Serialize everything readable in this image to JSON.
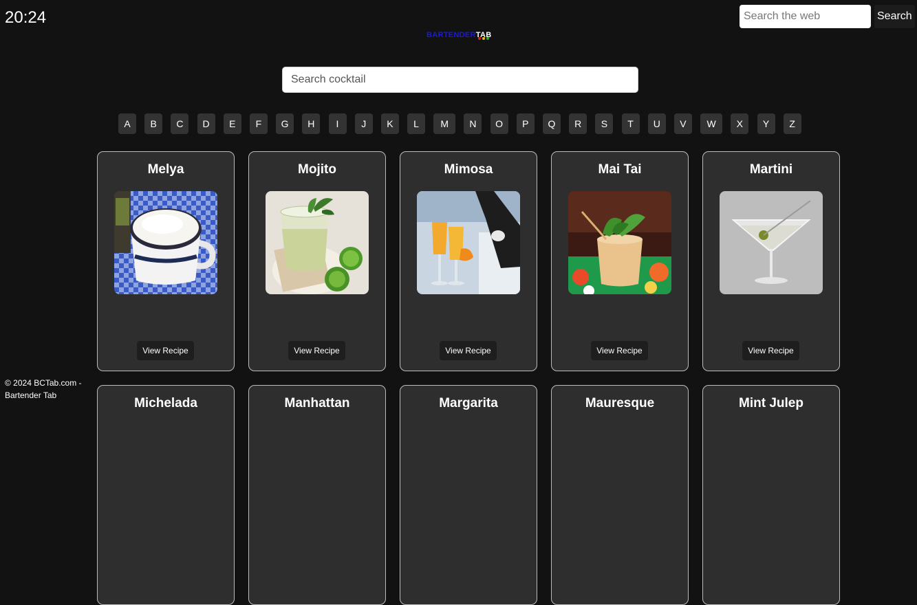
{
  "clock": {
    "time": "20:24"
  },
  "web_search": {
    "placeholder": "Search the web",
    "button_label": "Search"
  },
  "logo": {
    "part1": "BARTENDER",
    "part2": "TAB",
    "dot_colors": [
      "#e02020",
      "#f0c000",
      "#20b030"
    ]
  },
  "cocktail_search": {
    "placeholder": "Search cocktail"
  },
  "alphabet": [
    "A",
    "B",
    "C",
    "D",
    "E",
    "F",
    "G",
    "H",
    "I",
    "J",
    "K",
    "L",
    "M",
    "N",
    "O",
    "P",
    "Q",
    "R",
    "S",
    "T",
    "U",
    "V",
    "W",
    "X",
    "Y",
    "Z"
  ],
  "cards": [
    {
      "name": "Melya",
      "button": "View Recipe",
      "image": "coffee-cup-on-checkered-cloth"
    },
    {
      "name": "Mojito",
      "button": "View Recipe",
      "image": "mojito-glass-with-mint-and-limes"
    },
    {
      "name": "Mimosa",
      "button": "View Recipe",
      "image": "mimosa-flutes-with-champagne-bottle"
    },
    {
      "name": "Mai Tai",
      "button": "View Recipe",
      "image": "mai-tai-with-mint-on-floral-cloth"
    },
    {
      "name": "Martini",
      "button": "View Recipe",
      "image": "martini-glass-with-olive"
    },
    {
      "name": "Michelada",
      "button": "",
      "image": ""
    },
    {
      "name": "Manhattan",
      "button": "",
      "image": ""
    },
    {
      "name": "Margarita",
      "button": "",
      "image": ""
    },
    {
      "name": "Mauresque",
      "button": "",
      "image": ""
    },
    {
      "name": "Mint Julep",
      "button": "",
      "image": ""
    }
  ],
  "footer": {
    "text": "© 2024 BCTab.com - Bartender Tab"
  },
  "colors": {
    "background": "#121212",
    "card": "#2e2e2e",
    "letter_button": "#333333",
    "logo_blue": "#1a1ad8"
  }
}
